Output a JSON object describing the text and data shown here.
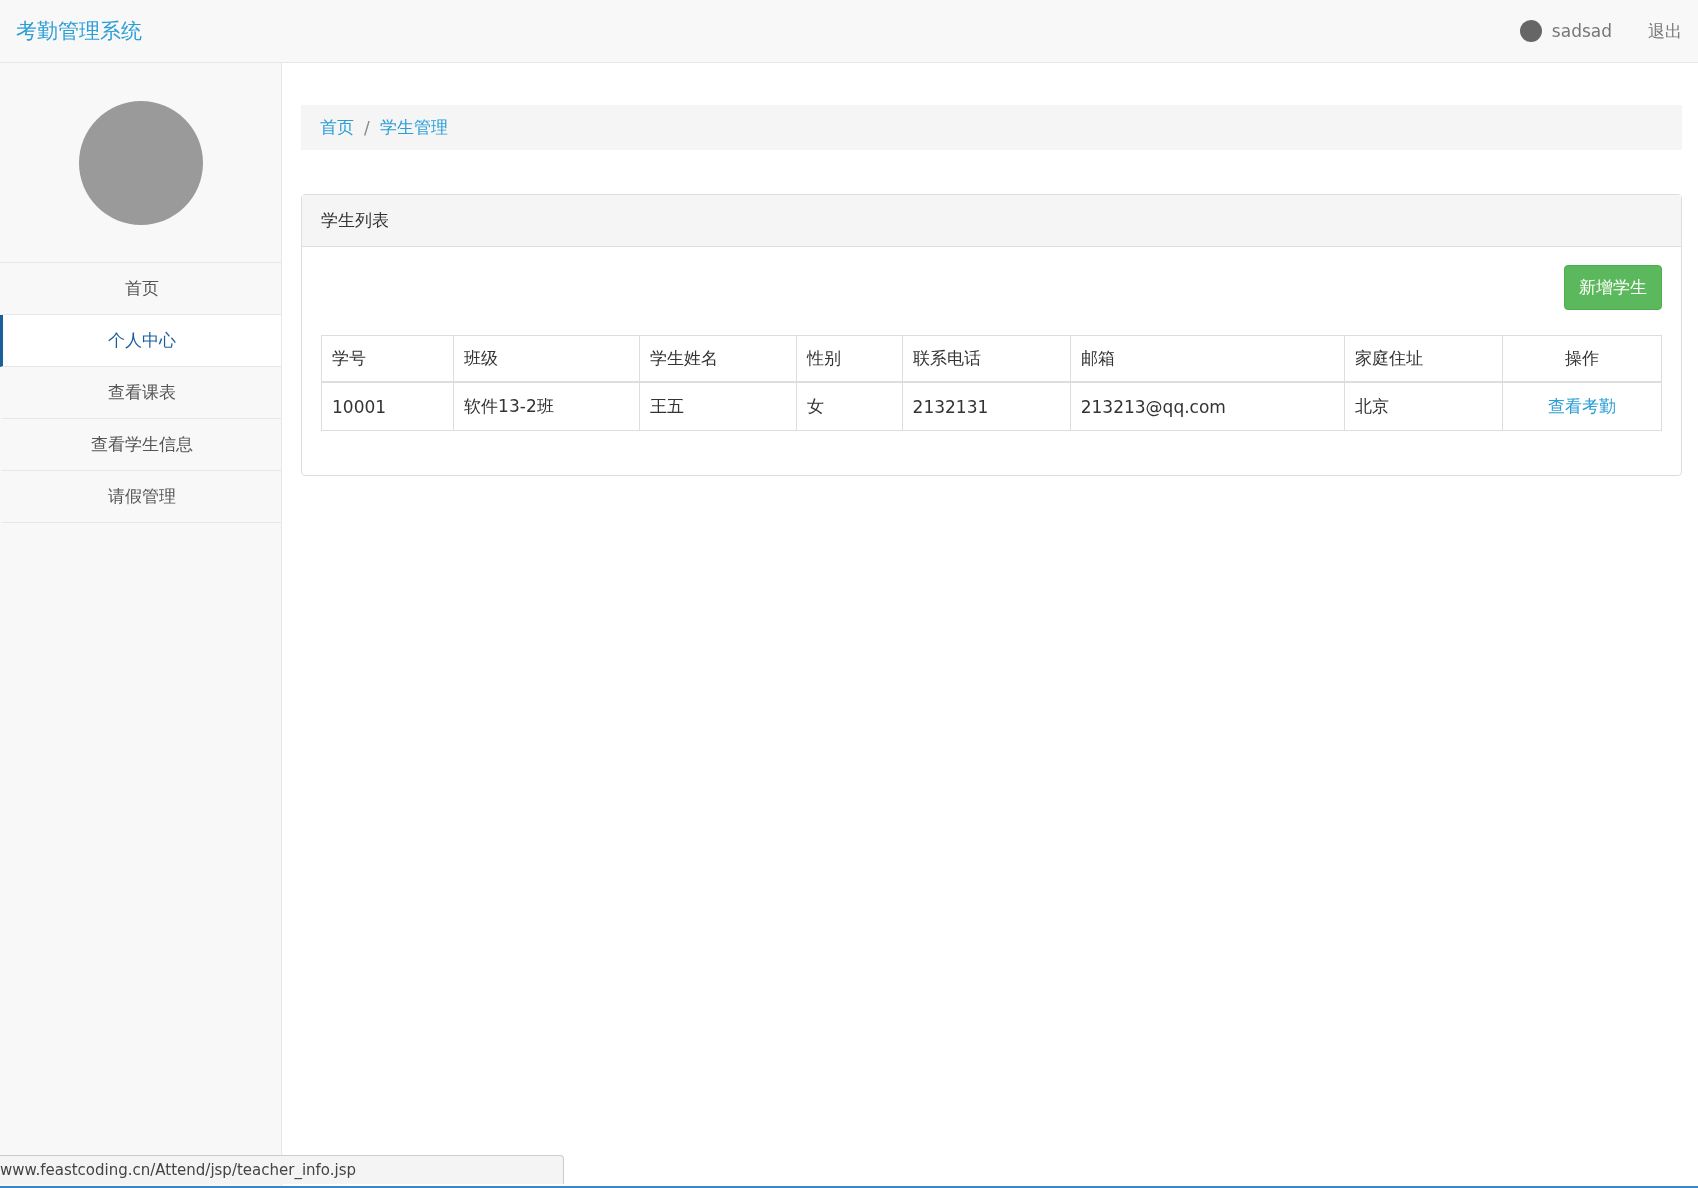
{
  "header": {
    "title": "考勤管理系统",
    "user": "sadsad",
    "logout": "退出"
  },
  "sidebar": {
    "items": [
      {
        "label": "首页",
        "selected": false
      },
      {
        "label": "个人中心",
        "selected": true
      },
      {
        "label": "查看课表",
        "selected": false
      },
      {
        "label": "查看学生信息",
        "selected": false
      },
      {
        "label": "请假管理",
        "selected": false
      }
    ]
  },
  "breadcrumb": {
    "items": [
      "首页",
      "学生管理"
    ],
    "separator": "/"
  },
  "panel": {
    "title": "学生列表",
    "add_button": "新增学生"
  },
  "table": {
    "columns": [
      "学号",
      "班级",
      "学生姓名",
      "性别",
      "联系电话",
      "邮箱",
      "家庭住址",
      "操作"
    ],
    "rows": [
      {
        "cells": [
          "10001",
          "软件13-2班",
          "王五",
          "女",
          "2132131",
          "213213@qq.com",
          "北京"
        ],
        "action": "查看考勤"
      }
    ]
  },
  "status_bar": "www.feastcoding.cn/Attend/jsp/teacher_info.jsp"
}
